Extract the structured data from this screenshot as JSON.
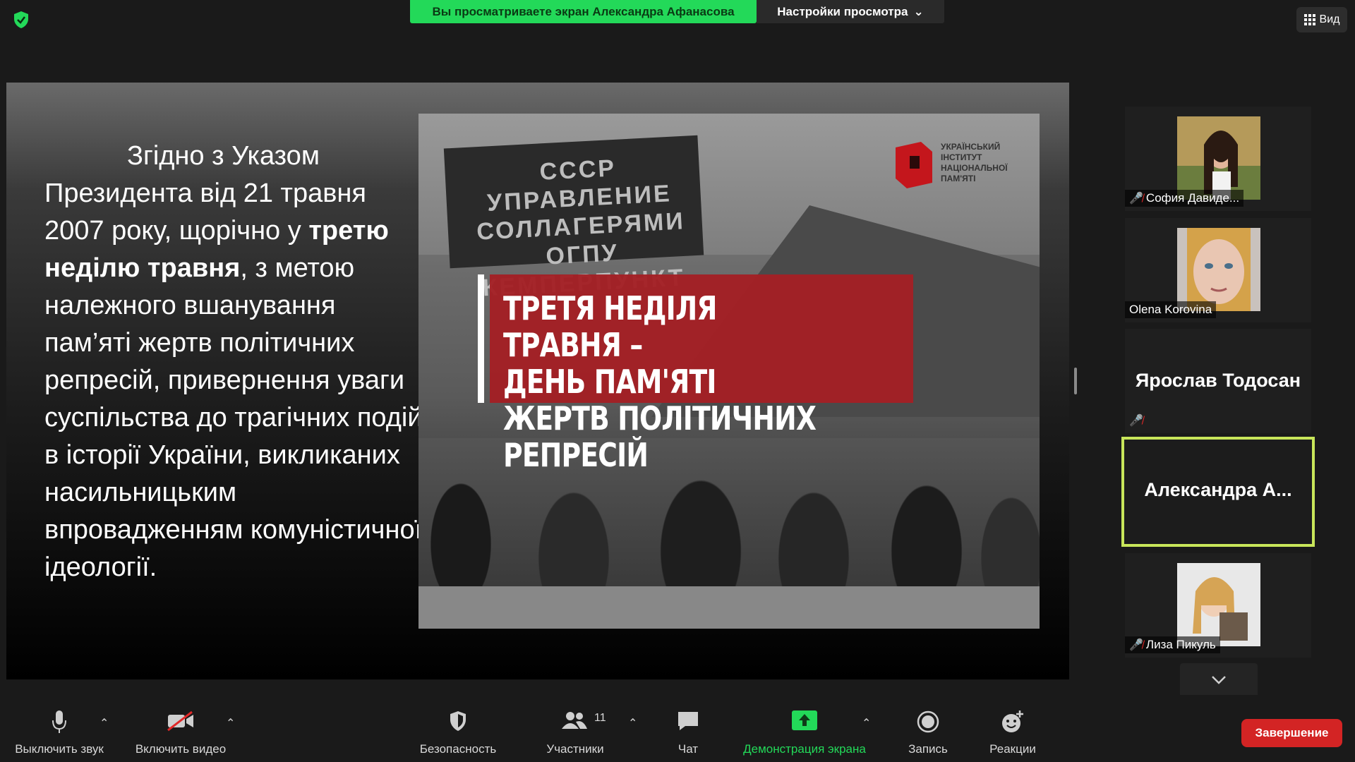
{
  "top": {
    "banner": "Вы просматриваете экран Александра Афанасова",
    "view_settings": "Настройки просмотра",
    "view_button": "Вид"
  },
  "slide": {
    "text_line1": "Згідно з Указом",
    "text_part2": "Президента від 21 травня 2007 року, щорічно у ",
    "text_bold": "третю неділю травня",
    "text_part3": ", з метою належного вшанування пам’яті жертв політичних репресій, привернення уваги суспільства до трагічних подій в історії України, викликаних насильницьким впровадженням комуністичної ідеології.",
    "photo_sign": "СССР УПРАВЛЕНИЕ СОЛЛАГЕРЯМИ ОГПУ КЕМПЕРПУНКТ",
    "red_line1": "ТРЕТЯ НЕДІЛЯ ТРАВНЯ –",
    "red_line2": "ДЕНЬ ПАМ'ЯТІ",
    "red_line3": "ЖЕРТВ ПОЛІТИЧНИХ РЕПРЕСІЙ",
    "logo_text": "УКРАЇНСЬКИЙ ІНСТИТУТ НАЦІОНАЛЬНОЇ ПАМ'ЯТІ"
  },
  "participants": [
    {
      "name": "София Давиде...",
      "muted": true
    },
    {
      "name": "Olena Korovina",
      "muted": false
    },
    {
      "name": "Ярослав Тодосан",
      "muted": true
    },
    {
      "name": "Александра  А...",
      "muted": false,
      "active": true
    },
    {
      "name": "Лиза Пикуль",
      "muted": true
    }
  ],
  "toolbar": {
    "mute": "Выключить звук",
    "video": "Включить видео",
    "security": "Безопасность",
    "participants": "Участники",
    "participants_count": "11",
    "chat": "Чат",
    "share": "Демонстрация экрана",
    "record": "Запись",
    "reactions": "Реакции",
    "end": "Завершение"
  },
  "colors": {
    "accent_green": "#23d959",
    "end_red": "#d32424",
    "slide_red": "#a31f24",
    "active_border": "#c8e65a"
  }
}
